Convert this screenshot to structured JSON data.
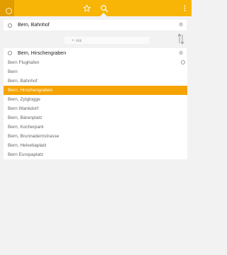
{
  "toolbar": {
    "icons": [
      "location-icon",
      "star-icon",
      "search-icon",
      "more-vertical-icon"
    ]
  },
  "from": {
    "value": "Bern, Bahnhof"
  },
  "via": {
    "label": "+ via"
  },
  "to": {
    "value": "Bern, Hirschengraben"
  },
  "suggestions": [
    {
      "label": "Bern Flughafen",
      "history": true
    },
    {
      "label": "Bern"
    },
    {
      "label": "Bern, Bahnhof"
    },
    {
      "label": "Bern, Hirschengraben",
      "selected": true
    },
    {
      "label": "Bern, Zytglogge"
    },
    {
      "label": "Bern Wankdorf"
    },
    {
      "label": "Bern, Bärenplatz"
    },
    {
      "label": "Bern, Kocherpark"
    },
    {
      "label": "Bern, Brunnadernstrasse"
    },
    {
      "label": "Bern, Helvetiaplatz"
    },
    {
      "label": "Bern Europaplatz"
    }
  ],
  "colors": {
    "accent": "#f8b506",
    "selected": "#f5a300"
  }
}
